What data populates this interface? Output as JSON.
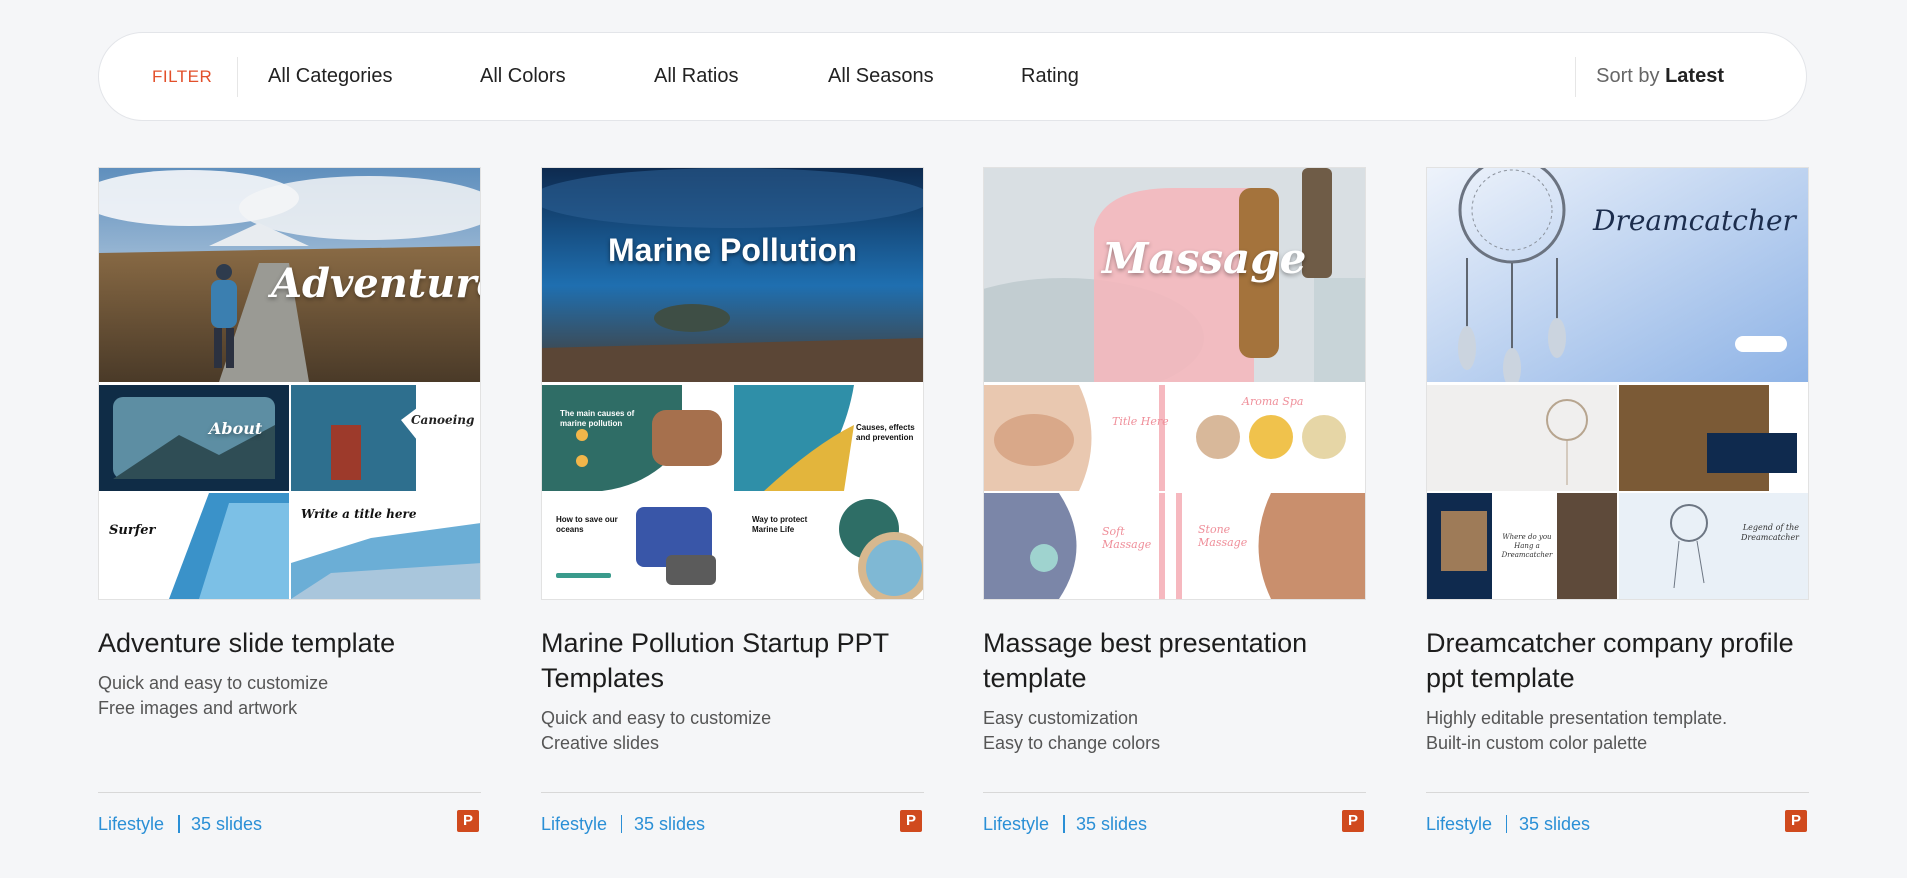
{
  "filter_bar": {
    "filter_label": "FILTER",
    "items": [
      "All Categories",
      "All Colors",
      "All Ratios",
      "All Seasons",
      "Rating"
    ],
    "sort_prefix": "Sort by",
    "sort_value": "Latest"
  },
  "cards": [
    {
      "hero_text": "Adventure",
      "mini_labels": [
        "About",
        "Canoeing",
        "Surfer",
        "Write a title here"
      ],
      "title": "Adventure slide template",
      "desc_line1": "Quick and easy to customize",
      "desc_line2": "Free images and artwork",
      "category": "Lifestyle",
      "slides": "35 slides",
      "format_icon": "P"
    },
    {
      "hero_text": "Marine Pollution",
      "mini_labels": [
        "The main causes of marine pollution",
        "Causes, effects and prevention",
        "How to save our oceans",
        "Way to protect Marine Life"
      ],
      "title": "Marine Pollution Startup PPT Templates",
      "desc_line1": "Quick and easy to customize",
      "desc_line2": "Creative slides",
      "category": "Lifestyle",
      "slides": "35 slides",
      "format_icon": "P"
    },
    {
      "hero_text": "Massage",
      "mini_labels": [
        "Title Here",
        "Aroma Spa",
        "Soft Massage",
        "Stone Massage"
      ],
      "title": "Massage best presentation template",
      "desc_line1": "Easy customization",
      "desc_line2": "Easy to change colors",
      "category": "Lifestyle",
      "slides": "35 slides",
      "format_icon": "P"
    },
    {
      "hero_text": "Dreamcatcher",
      "mini_labels": [
        "",
        "",
        "Where do you Hang a Dreamcatcher",
        "Legend of the Dreamcatcher"
      ],
      "title": "Dreamcatcher company profile ppt template",
      "desc_line1": "Highly editable presentation template.",
      "desc_line2": "Built-in custom color palette",
      "category": "Lifestyle",
      "slides": "35 slides",
      "format_icon": "P"
    }
  ],
  "colors": {
    "accent_blue": "#2a8fd6",
    "filter_red": "#e2502b",
    "ppt_orange": "#d04a1e"
  }
}
